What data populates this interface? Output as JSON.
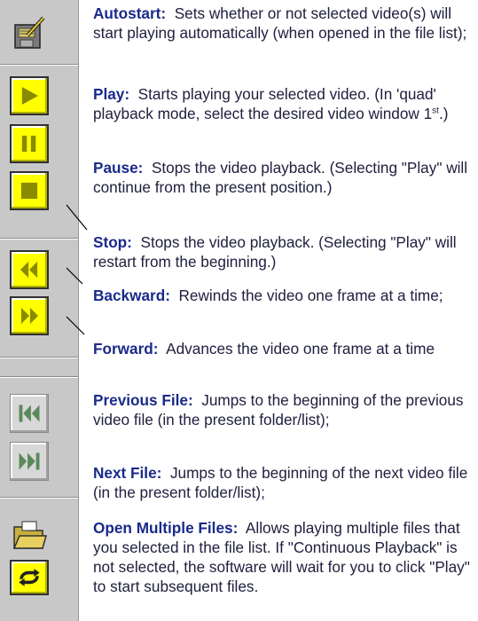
{
  "items": [
    {
      "term": "Autostart:",
      "text": "Sets whether or not selected video(s) will start playing automatically (when opened in the file list);"
    },
    {
      "term": "Play:",
      "text": "Starts playing your selected video. (In 'quad' playback mode, select the desired video window 1",
      "sup": "st",
      "text_after": ".)"
    },
    {
      "term": "Pause:",
      "text": "Stops the video playback. (Selecting \"Play\" will continue from the present position.)"
    },
    {
      "term": "Stop:",
      "text": "Stops the video playback. (Selecting \"Play\" will restart from the beginning.)"
    },
    {
      "term": "Backward:",
      "text": "Rewinds the video one frame at a time;"
    },
    {
      "term": "Forward:",
      "text": "Advances the video one frame at a time"
    },
    {
      "term": "Previous File:",
      "text": "Jumps to the beginning of the previous video file (in the present folder/list);"
    },
    {
      "term": "Next File:",
      "text": "Jumps to the beginning of the next video file (in the present folder/list);"
    },
    {
      "term": "Open Multiple Files:",
      "text": "Allows playing multiple files that you selected in the file list. If \"Continuous Playback\" is not selected, the software will wait for you to click \"Play\" to start subsequent files."
    }
  ],
  "colors": {
    "toolbar": "#c8c8c8",
    "button_active": "#ffff00",
    "button_disabled": "#d8d8d8",
    "term": "#1a2a8a",
    "text": "#202040"
  },
  "icons": [
    "autostart-icon",
    "play-icon",
    "pause-icon",
    "stop-icon",
    "backward-icon",
    "forward-icon",
    "previous-file-icon",
    "next-file-icon",
    "open-multiple-files-icon",
    "continuous-playback-icon"
  ]
}
